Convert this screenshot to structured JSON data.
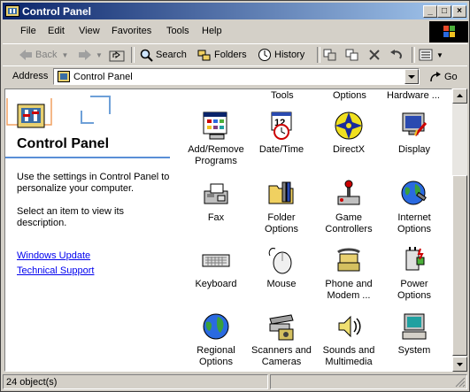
{
  "window": {
    "title": "Control Panel"
  },
  "title_buttons": {
    "minimize": "_",
    "maximize": "□",
    "close": "×"
  },
  "menu": [
    "File",
    "Edit",
    "View",
    "Favorites",
    "Tools",
    "Help"
  ],
  "toolbar": {
    "back": "Back",
    "search": "Search",
    "folders": "Folders",
    "history": "History"
  },
  "address": {
    "label": "Address",
    "value": "Control Panel",
    "go": "Go"
  },
  "left_pane": {
    "title": "Control Panel",
    "description": "Use the settings in Control Panel to personalize your computer.",
    "hint": "Select an item to view its description.",
    "links": [
      "Windows Update",
      "Technical Support"
    ]
  },
  "partial_row": [
    "Tools",
    "Options",
    "Hardware ..."
  ],
  "items": [
    {
      "label": "Add/Remove Programs",
      "icon": "add-remove-programs-icon"
    },
    {
      "label": "Date/Time",
      "icon": "date-time-icon"
    },
    {
      "label": "DirectX",
      "icon": "directx-icon"
    },
    {
      "label": "Display",
      "icon": "display-icon"
    },
    {
      "label": "Fax",
      "icon": "fax-icon"
    },
    {
      "label": "Folder Options",
      "icon": "folder-options-icon"
    },
    {
      "label": "Game Controllers",
      "icon": "game-controllers-icon"
    },
    {
      "label": "Internet Options",
      "icon": "internet-options-icon"
    },
    {
      "label": "Keyboard",
      "icon": "keyboard-icon"
    },
    {
      "label": "Mouse",
      "icon": "mouse-icon"
    },
    {
      "label": "Phone and Modem ...",
      "icon": "phone-modem-icon"
    },
    {
      "label": "Power Options",
      "icon": "power-options-icon"
    },
    {
      "label": "Regional Options",
      "icon": "regional-options-icon"
    },
    {
      "label": "Scanners and Cameras",
      "icon": "scanners-cameras-icon"
    },
    {
      "label": "Sounds and Multimedia",
      "icon": "sounds-multimedia-icon"
    },
    {
      "label": "System",
      "icon": "system-icon"
    }
  ],
  "status": {
    "count": "24 object(s)"
  }
}
